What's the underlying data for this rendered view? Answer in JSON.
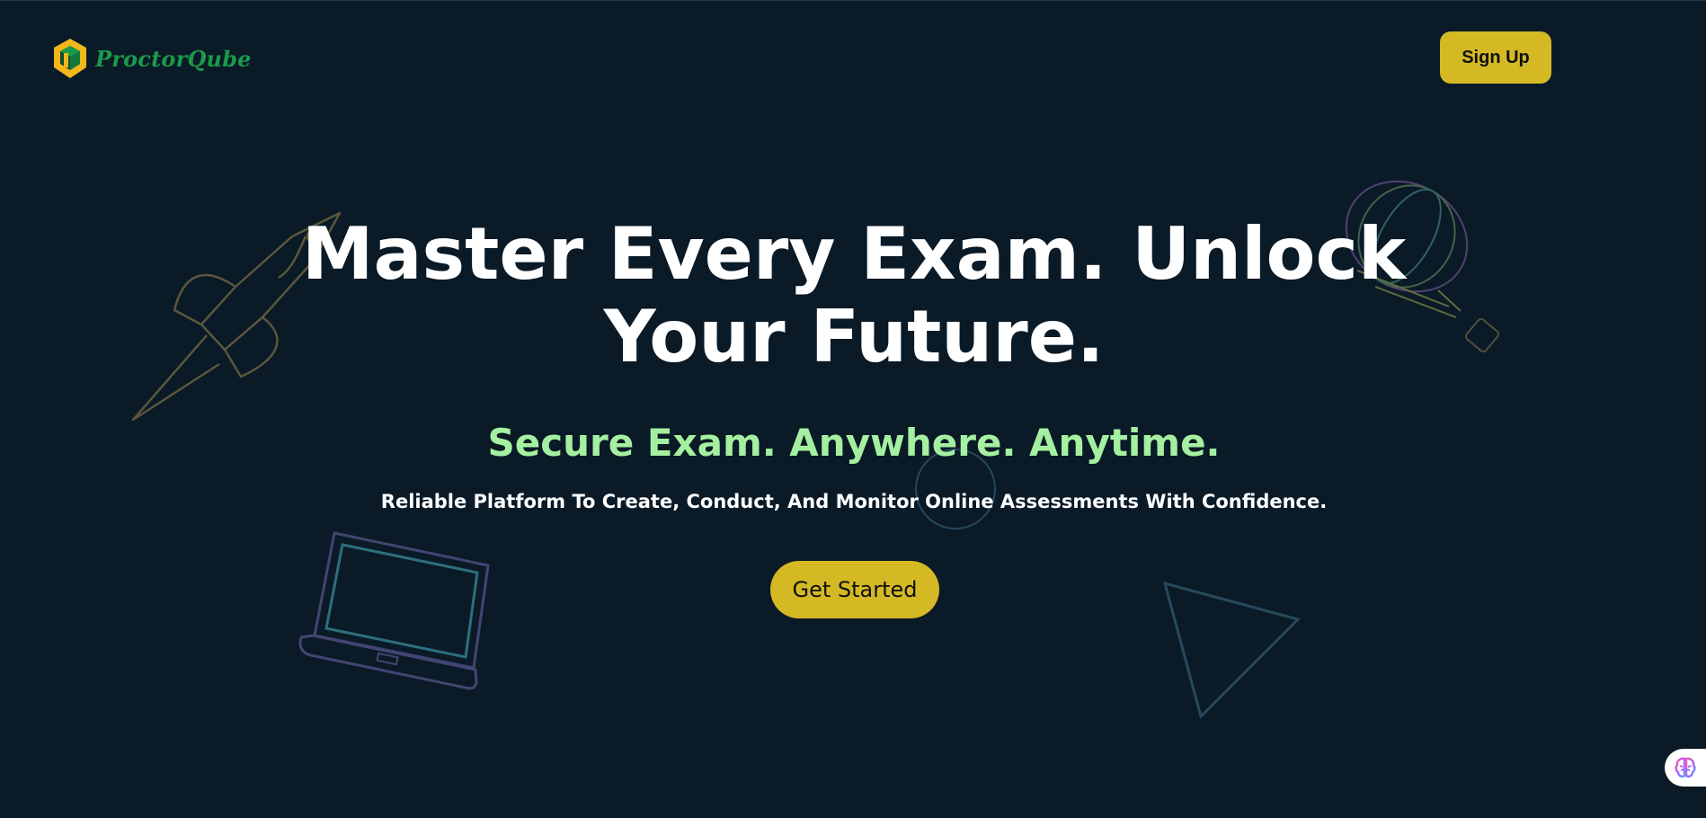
{
  "brand": {
    "name": "ProctorQube",
    "icon": "cube-logo-icon",
    "colors": {
      "green": "#1a9a4a",
      "gold": "#f2b71a"
    }
  },
  "header": {
    "signup_label": "Sign Up"
  },
  "hero": {
    "title_line1": "Master Every Exam. Unlock",
    "title_line2": "Your Future.",
    "tagline": "Secure Exam. Anywhere. Anytime.",
    "description": "Reliable Platform To Create, Conduct, And Monitor Online Assessments With Confidence.",
    "cta_label": "Get Started"
  },
  "decorations": [
    "rocket-icon",
    "hot-air-balloon-icon",
    "laptop-icon",
    "triangle-icon",
    "circle-icon"
  ],
  "assistant": {
    "icon": "brain-icon"
  },
  "theme": {
    "background": "#0a1a27",
    "accent": "#d4b924",
    "tagline_color": "#a4f0a0"
  }
}
